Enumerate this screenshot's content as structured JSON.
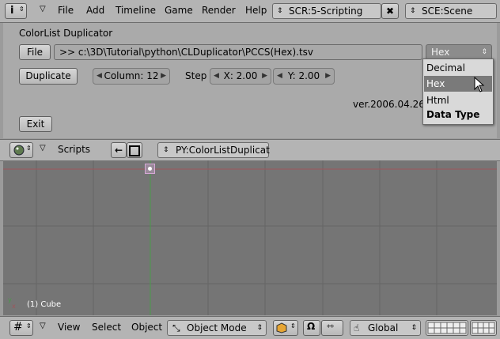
{
  "topbar": {
    "menu": [
      "File",
      "Add",
      "Timeline",
      "Game",
      "Render",
      "Help"
    ],
    "screen_value": "SCR:5-Scripting",
    "scene_value": "SCE:Scene"
  },
  "panel": {
    "title": "ColorList Duplicator",
    "file_button": "File",
    "path_value": ">> c:\\3D\\Tutorial\\python\\CLDuplicator\\PCCS(Hex).tsv",
    "data_type_selected": "Hex",
    "duplicate_button": "Duplicate",
    "column_field": "Column: 12",
    "step_label": "Step",
    "x_field": "X: 2.00",
    "y_field": "Y: 2.00",
    "version_text": "ver.2006.04.26(",
    "exit_button": "Exit"
  },
  "dropdown": {
    "items": [
      "Decimal",
      "Hex",
      "Html"
    ],
    "highlighted": "Hex",
    "title": "Data Type"
  },
  "scriptbar": {
    "label": "Scripts",
    "script_name": "PY:ColorListDuplicat"
  },
  "viewport": {
    "object_label": "(1) Cube",
    "axis_y": "y",
    "axis_x": "x"
  },
  "bottombar": {
    "menu": [
      "View",
      "Select",
      "Object"
    ],
    "mode": "Object Mode",
    "orientation": "Global"
  },
  "colors": {
    "ui_bg": "#b4b4b4",
    "panel_bg": "#aaaaaa",
    "viewport_bg": "#757575",
    "grid": "#656565",
    "highlight": "#7a7a7a",
    "axis_red": "#a0555a",
    "axis_green": "#4a9a4a",
    "selection": "#d8a8d8"
  },
  "icons": [
    "info-icon",
    "arrow-down-icon",
    "close-icon",
    "python-icon",
    "arrow-left-icon",
    "window-icon",
    "grid-icon",
    "cube-icon",
    "magnet-icon",
    "hand-icon",
    "layers-icon",
    "cursor-icon"
  ]
}
